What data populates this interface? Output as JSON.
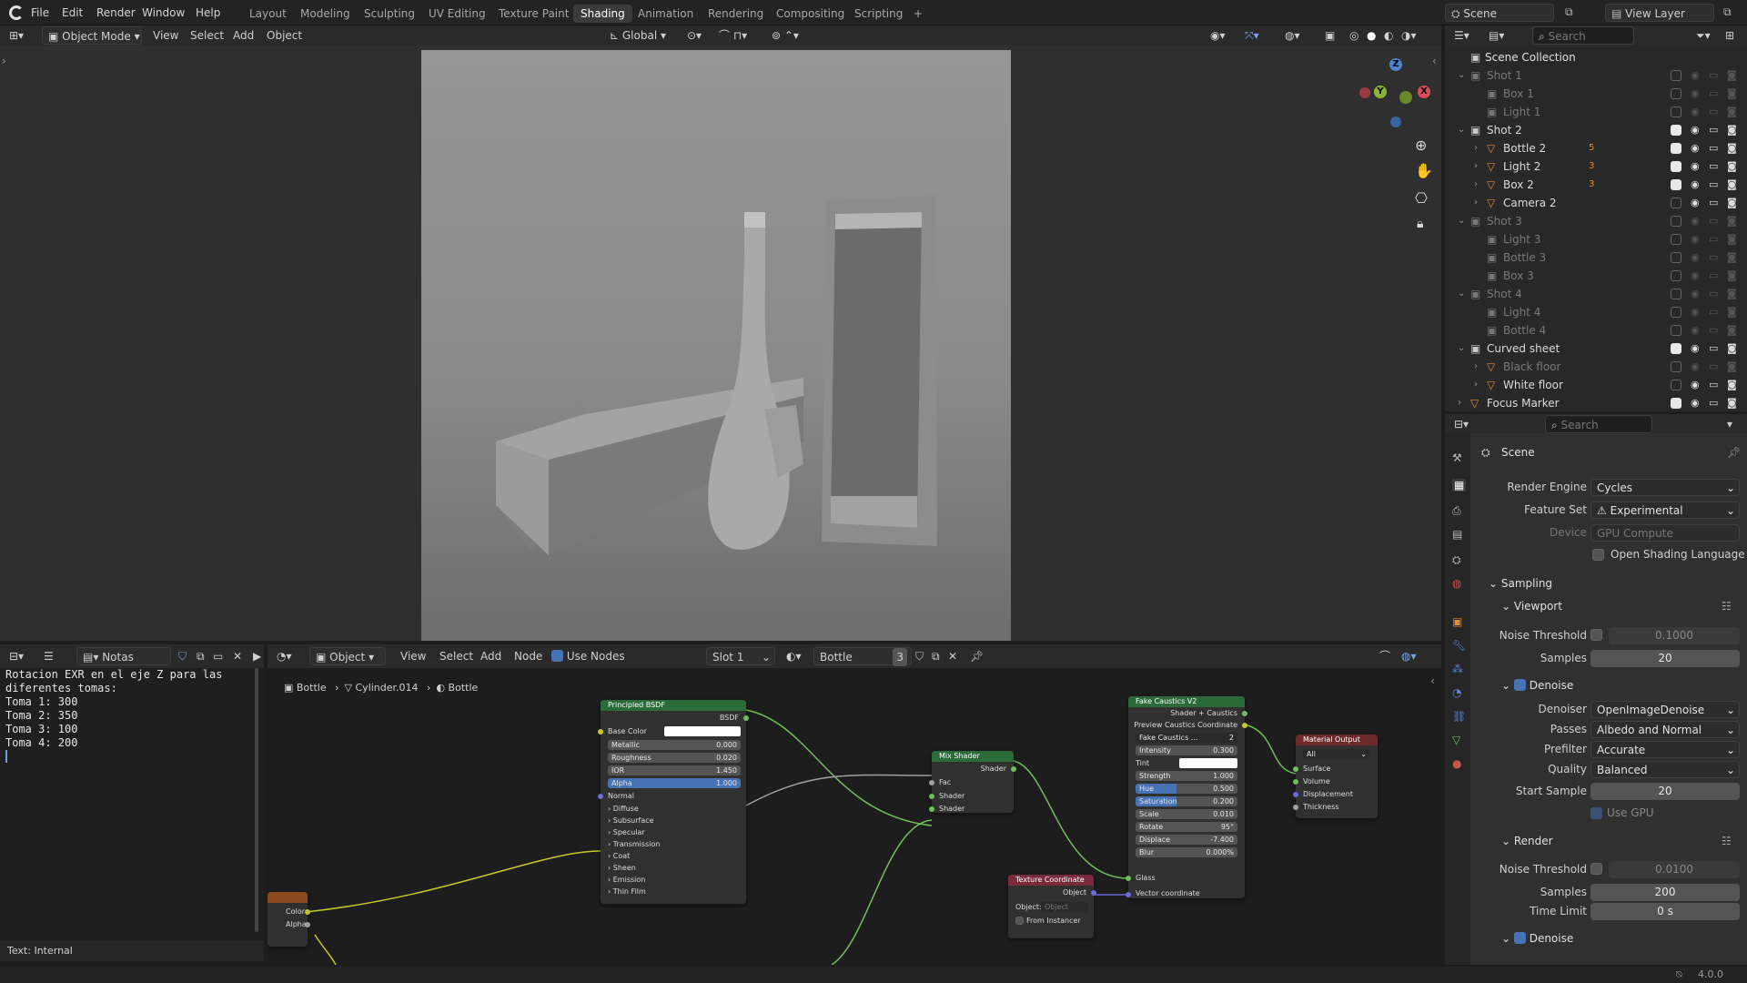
{
  "menu": {
    "file": "File",
    "edit": "Edit",
    "render": "Render",
    "window": "Window",
    "help": "Help"
  },
  "workspaces": [
    "Layout",
    "Modeling",
    "Sculpting",
    "UV Editing",
    "Texture Paint",
    "Shading",
    "Animation",
    "Rendering",
    "Compositing",
    "Scripting",
    "+"
  ],
  "top_right": {
    "scene": "Scene",
    "view_layer": "View Layer"
  },
  "viewport_header": {
    "mode": "Object Mode",
    "view": "View",
    "select": "Select",
    "add": "Add",
    "object": "Object",
    "orientation": "Global"
  },
  "gizmo": {
    "x": "X",
    "y": "Y",
    "z": "Z"
  },
  "outliner": {
    "search_placeholder": "Search",
    "root": "Scene Collection",
    "rows": [
      {
        "label": "Shot 1",
        "dim": true
      },
      {
        "label": "Box 1",
        "dim": true
      },
      {
        "label": "Light 1",
        "dim": true
      },
      {
        "label": "Shot 2",
        "dim": false
      },
      {
        "label": "Bottle 2",
        "dim": false
      },
      {
        "label": "Light 2",
        "dim": false
      },
      {
        "label": "Box 2",
        "dim": false
      },
      {
        "label": "Camera 2",
        "dim": false
      },
      {
        "label": "Shot 3",
        "dim": true
      },
      {
        "label": "Light 3",
        "dim": true
      },
      {
        "label": "Bottle 3",
        "dim": true
      },
      {
        "label": "Box 3",
        "dim": true
      },
      {
        "label": "Shot 4",
        "dim": true
      },
      {
        "label": "Light 4",
        "dim": true
      },
      {
        "label": "Bottle 4",
        "dim": true
      },
      {
        "label": "Curved sheet",
        "dim": false
      },
      {
        "label": "Black floor",
        "dim": true
      },
      {
        "label": "White floor",
        "dim": false
      },
      {
        "label": "Focus Marker",
        "dim": false
      }
    ],
    "badges": {
      "bottle2": "5",
      "light2": "3",
      "box2": "3"
    }
  },
  "properties": {
    "search_placeholder": "Search",
    "scene": "Scene",
    "render_engine_label": "Render Engine",
    "render_engine": "Cycles",
    "feature_set_label": "Feature Set",
    "feature_set": "Experimental",
    "device_label": "Device",
    "device": "GPU Compute",
    "osl": "Open Shading Language",
    "sampling": "Sampling",
    "viewport": "Viewport",
    "noise_threshold_label": "Noise Threshold",
    "vp_noise": "0.1000",
    "samples_label": "Samples",
    "vp_samples": "20",
    "denoise": "Denoise",
    "denoiser_label": "Denoiser",
    "denoiser": "OpenImageDenoise",
    "passes_label": "Passes",
    "passes": "Albedo and Normal",
    "prefilter_label": "Prefilter",
    "prefilter": "Accurate",
    "quality_label": "Quality",
    "quality": "Balanced",
    "start_sample_label": "Start Sample",
    "start_sample": "20",
    "use_gpu": "Use GPU",
    "render": "Render",
    "r_noise": "0.0100",
    "r_samples": "200",
    "time_limit_label": "Time Limit",
    "time_limit": "0 s",
    "denoise2": "Denoise"
  },
  "text_editor": {
    "name": "Notas",
    "lines": [
      "Rotacion EXR en el eje Z para las",
      "diferentes tomas:",
      "Toma 1: 300",
      "Toma 2: 350",
      "Toma 3: 100",
      "Toma 4: 200"
    ],
    "footer": "Text: Internal"
  },
  "node_header": {
    "object": "Object",
    "view": "View",
    "select": "Select",
    "add": "Add",
    "node": "Node",
    "use_nodes": "Use Nodes",
    "slot": "Slot 1",
    "material": "Bottle",
    "users": "3"
  },
  "breadcrumb": {
    "a": "Bottle",
    "b": "Cylinder.014",
    "c": "Bottle"
  },
  "nodes": {
    "bsdf": {
      "title": "Principled BSDF",
      "out": "BSDF",
      "base_color": "Base Color",
      "metallic": "Metallic",
      "metallic_v": "0.000",
      "roughness": "Roughness",
      "roughness_v": "0.020",
      "ior": "IOR",
      "ior_v": "1.450",
      "alpha": "Alpha",
      "alpha_v": "1.000",
      "normal": "Normal",
      "panels": [
        "Diffuse",
        "Subsurface",
        "Specular",
        "Transmission",
        "Coat",
        "Sheen",
        "Emission",
        "Thin Film"
      ]
    },
    "mix": {
      "title": "Mix Shader",
      "out": "Shader",
      "fac": "Fac",
      "s1": "Shader",
      "s2": "Shader"
    },
    "caustics": {
      "title": "Fake Caustics V2",
      "out1": "Shader + Caustics",
      "out2": "Preview Caustics Coordinate",
      "group": "Fake Caustics ...",
      "users": "2",
      "intensity": "Intensity",
      "intensity_v": "0.300",
      "tint": "Tint",
      "strength": "Strength",
      "strength_v": "1.000",
      "hue": "Hue",
      "hue_v": "0.500",
      "saturation": "Saturation",
      "saturation_v": "0.200",
      "scale": "Scale",
      "scale_v": "0.010",
      "rotate": "Rotate",
      "rotate_v": "95°",
      "displace": "Displace",
      "displace_v": "-7.400",
      "blur": "Blur",
      "blur_v": "0.000%",
      "glass": "Glass",
      "vector": "Vector coordinate"
    },
    "output": {
      "title": "Material Output",
      "target": "All",
      "surface": "Surface",
      "volume": "Volume",
      "displacement": "Displacement",
      "thickness": "Thickness"
    },
    "texcoord": {
      "title": "Texture Coordinate",
      "out": "Object",
      "object_label": "Object:",
      "object_placeholder": "Object",
      "from_instancer": "From Instancer"
    },
    "image": {
      "color": "Color",
      "alpha": "Alpha"
    }
  },
  "status": {
    "version": "4.0.0"
  },
  "colors": {
    "accent": "#4772b3",
    "active_ws": "#3b3b3b",
    "bsdf_head": "#2b6b3a",
    "mix_head": "#2b6b3a",
    "caustics_head": "#2b6b3a",
    "output_head": "#6e2a2a",
    "texcoord_head": "#7a2a3a",
    "link_green": "#6ec05a",
    "link_yellow": "#c7c729",
    "link_gray": "#a0a0a0"
  }
}
